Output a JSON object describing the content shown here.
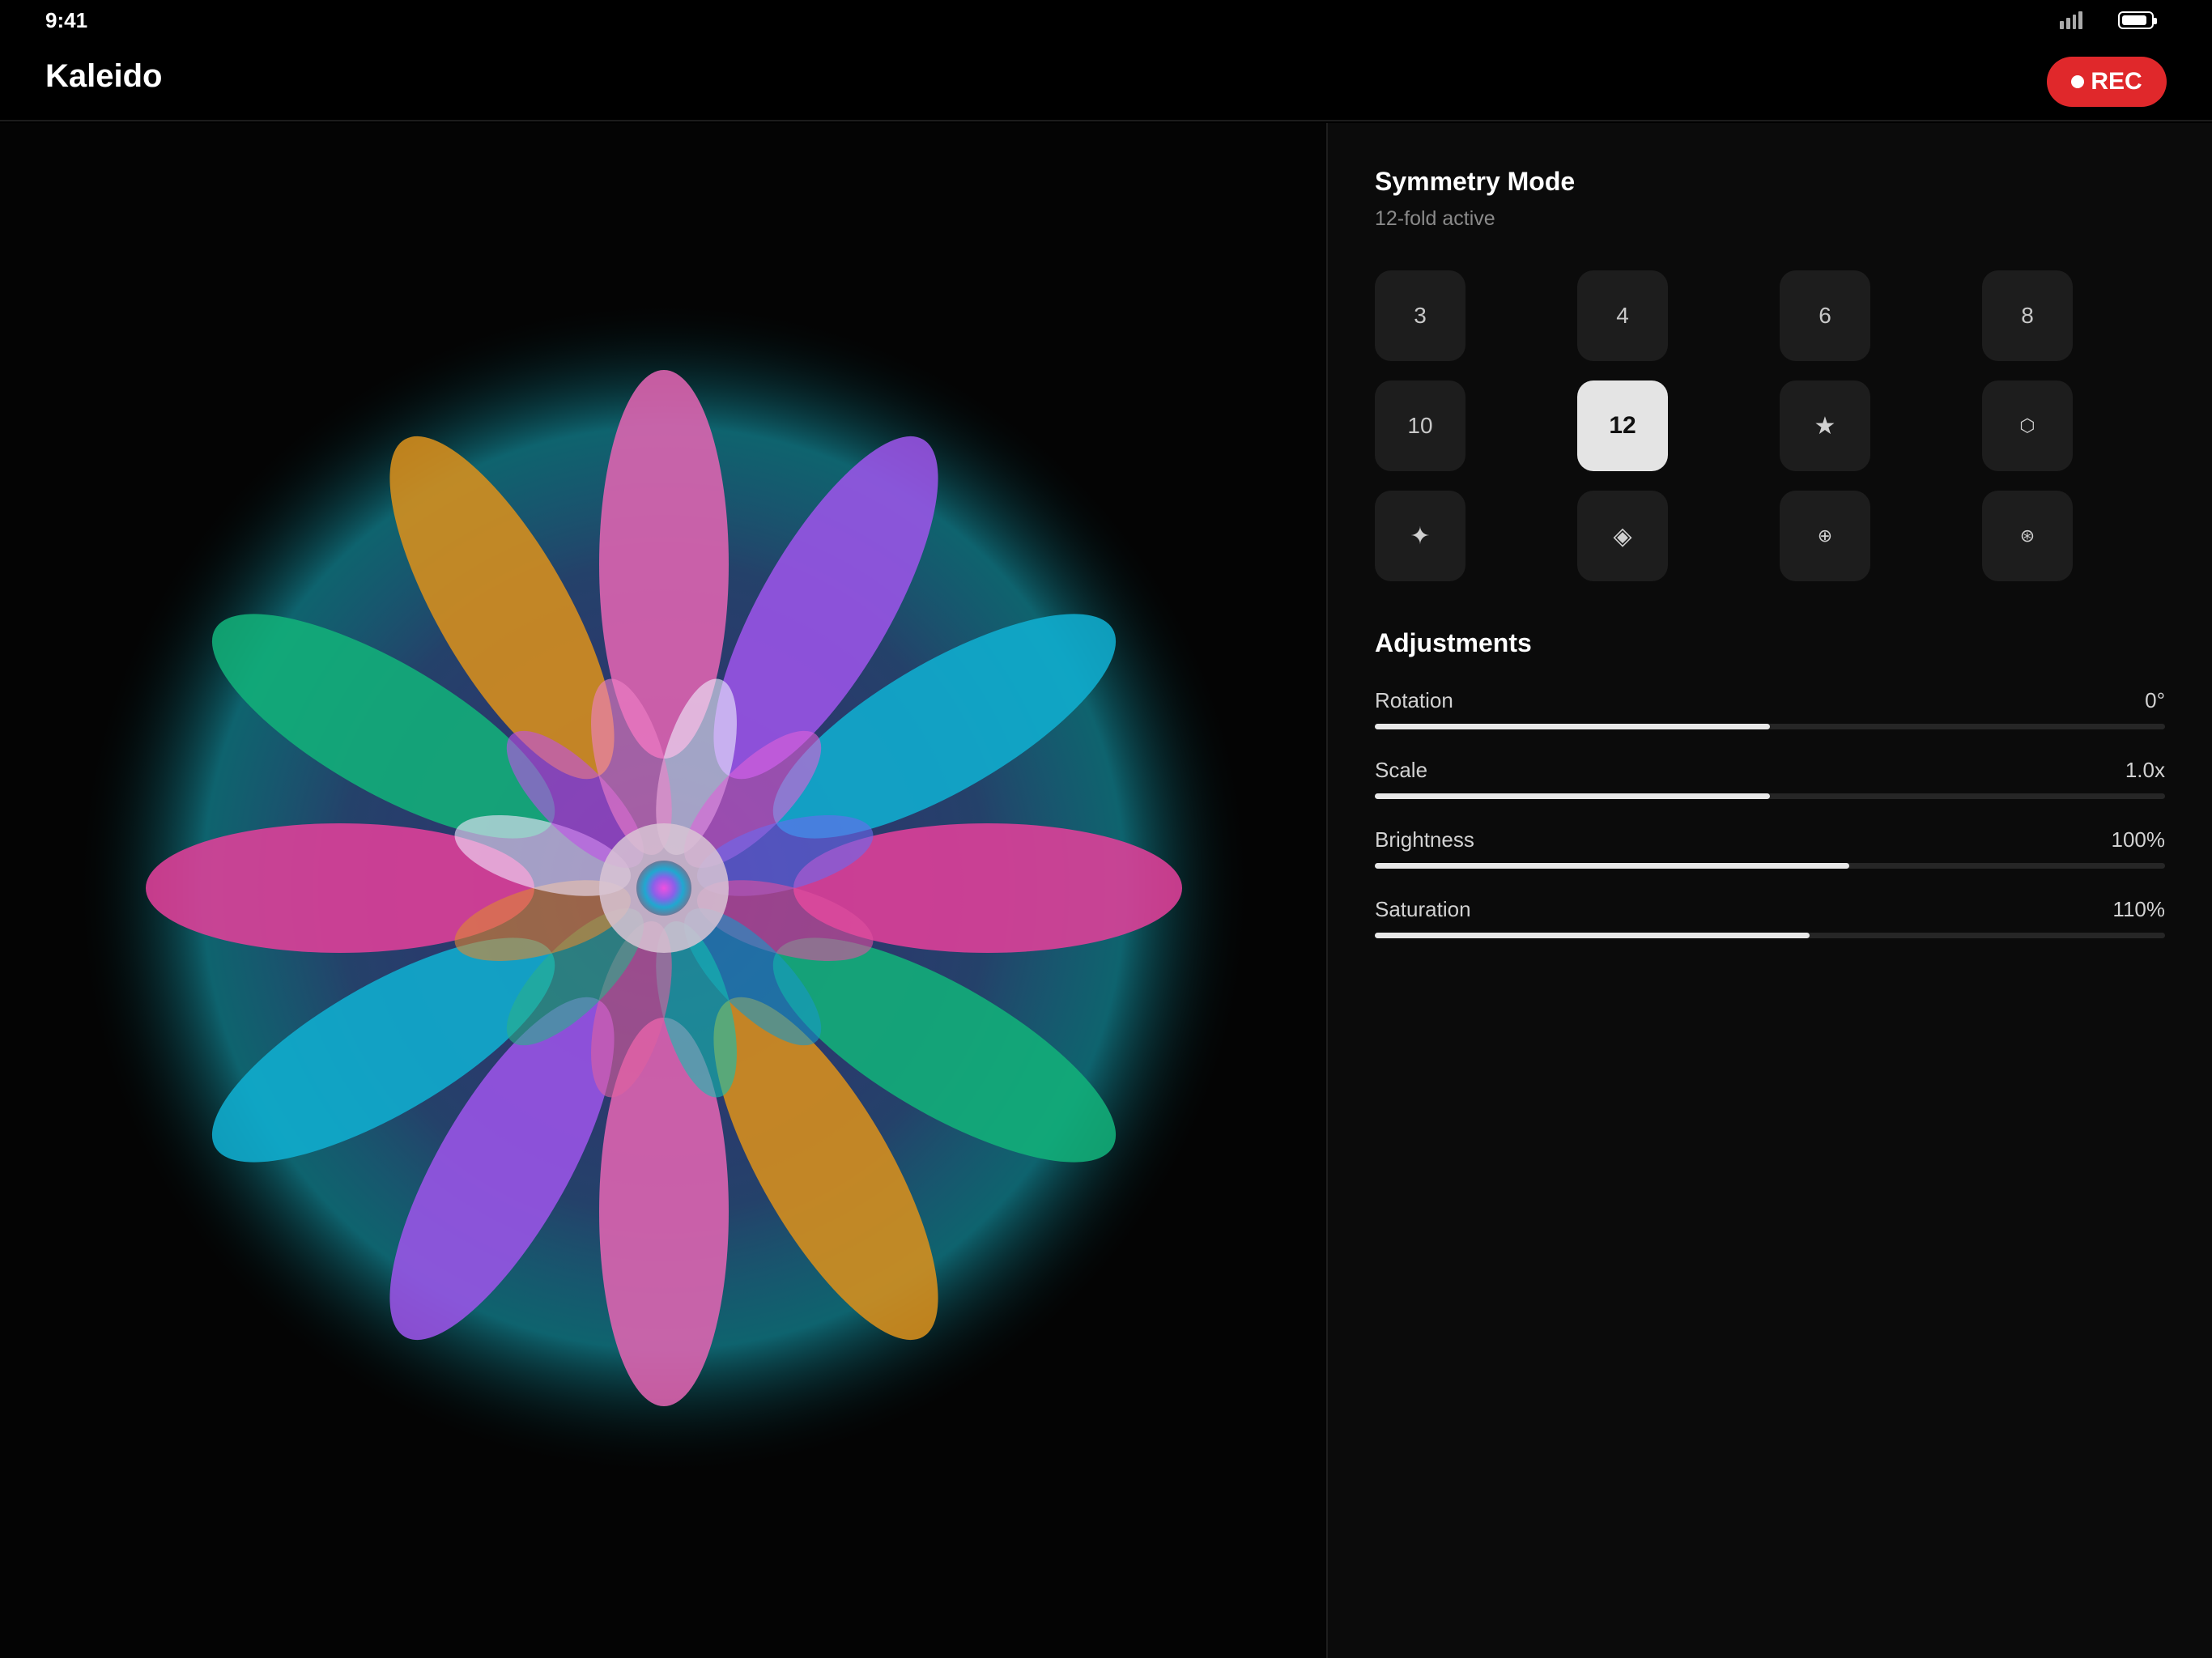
{
  "status_bar": {
    "time": "9:41",
    "icons": [
      "signal-icon",
      "battery-icon"
    ]
  },
  "header": {
    "title": "Kaleido",
    "rec_label": "REC",
    "rec_color": "#e0282b"
  },
  "canvas": {
    "description_icon": "kaleidoscope-pattern",
    "fold": 12,
    "petal_colors": [
      "#e064b2",
      "#9b54e8",
      "#10aed0",
      "#e0409a",
      "#12b07a",
      "#d8901c",
      "#e064b2",
      "#9b54e8",
      "#10aed0",
      "#e0409a",
      "#12b07a",
      "#d8901c"
    ],
    "glow_color": "#1fc7d6"
  },
  "symmetry": {
    "title": "Symmetry Mode",
    "subtitle": "12-fold active",
    "modes": [
      {
        "label": "3",
        "active": false
      },
      {
        "label": "4",
        "active": false
      },
      {
        "label": "6",
        "active": false
      },
      {
        "label": "8",
        "active": false
      },
      {
        "label": "10",
        "active": false
      },
      {
        "label": "12",
        "active": true
      },
      {
        "label": "★",
        "icon": "star-icon",
        "active": false
      },
      {
        "label": "⬡",
        "icon": "hexagon-icon",
        "active": false
      },
      {
        "label": "✦",
        "icon": "sparkle-icon",
        "active": false
      },
      {
        "label": "◈",
        "icon": "diamond-icon",
        "active": false
      },
      {
        "label": "⊕",
        "icon": "circled-plus-icon",
        "active": false
      },
      {
        "label": "⊛",
        "icon": "circled-asterisk-icon",
        "active": false
      }
    ]
  },
  "adjustments": {
    "title": "Adjustments",
    "sliders": [
      {
        "label": "Rotation",
        "value": "0°",
        "fill_fraction": 0.5
      },
      {
        "label": "Scale",
        "value": "1.0x",
        "fill_fraction": 0.5
      },
      {
        "label": "Brightness",
        "value": "100%",
        "fill_fraction": 0.6
      },
      {
        "label": "Saturation",
        "value": "110%",
        "fill_fraction": 0.55
      }
    ]
  }
}
